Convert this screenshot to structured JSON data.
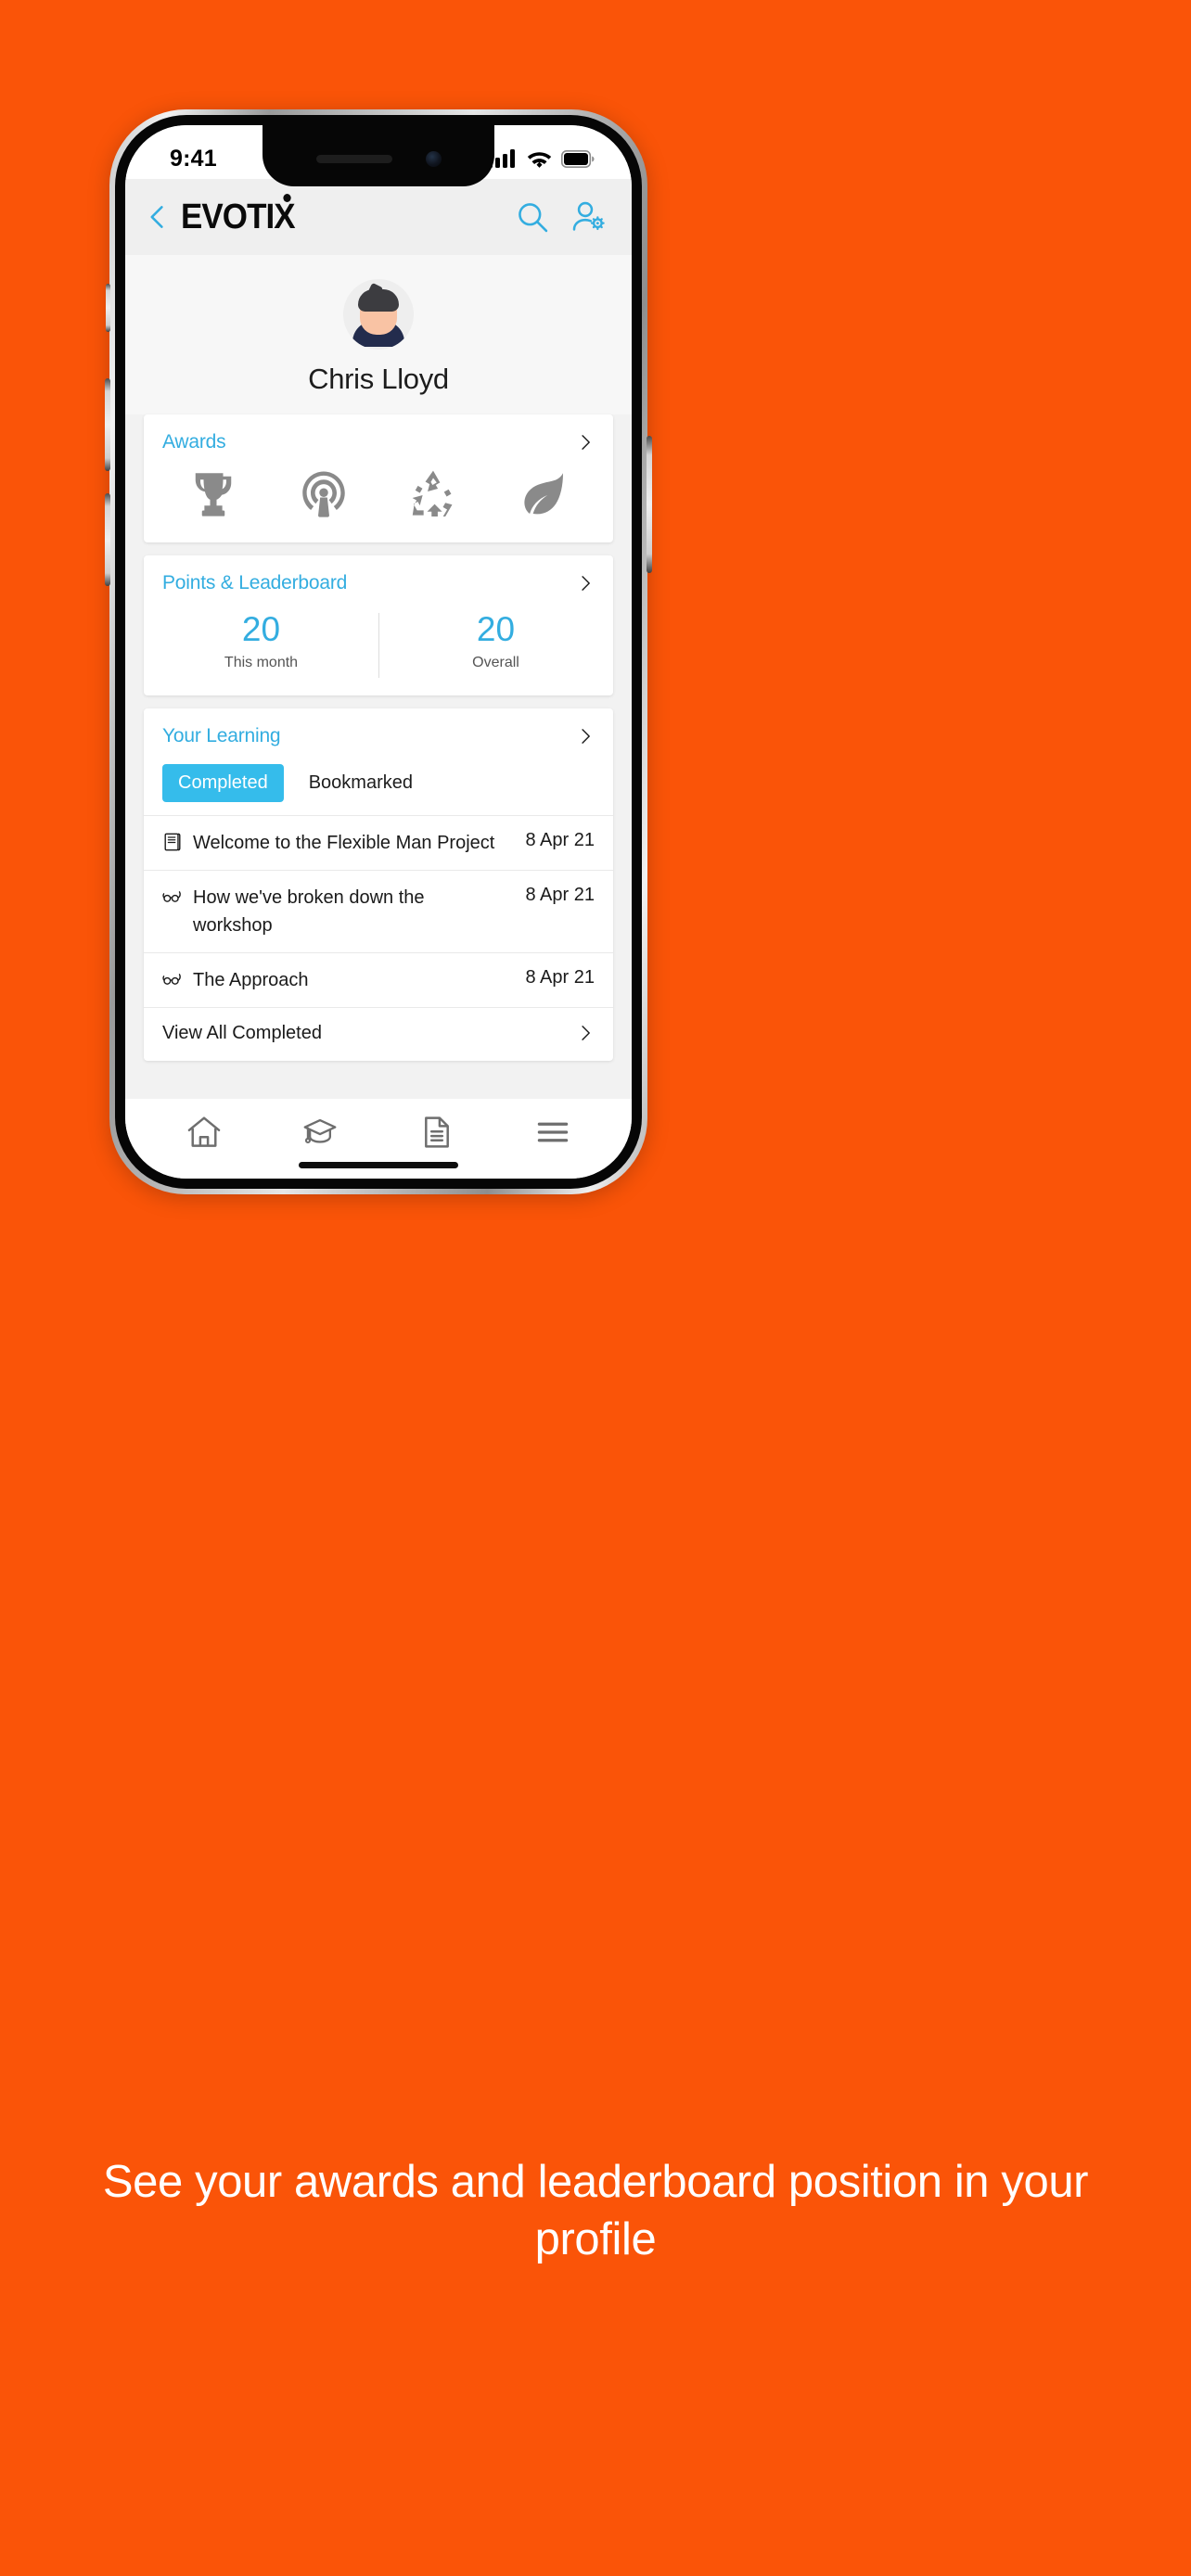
{
  "page": {
    "background_color": "#FA5408",
    "caption": "See your awards and leaderboard position in your profile"
  },
  "status_bar": {
    "time": "9:41",
    "signal_icon": "cellular-signal-icon",
    "wifi_icon": "wifi-icon",
    "battery_icon": "battery-icon"
  },
  "header": {
    "back_icon": "back-chevron-icon",
    "logo_text": "EVOTIX",
    "search_icon": "search-icon",
    "account_settings_icon": "user-settings-icon",
    "accent_color": "#33ADE0"
  },
  "profile": {
    "name": "Chris Lloyd",
    "avatar_icon": "user-avatar"
  },
  "awards": {
    "title": "Awards",
    "chevron_icon": "chevron-right-icon",
    "items": [
      {
        "icon": "trophy-icon"
      },
      {
        "icon": "broadcast-icon"
      },
      {
        "icon": "recycle-icon"
      },
      {
        "icon": "leaf-icon"
      }
    ]
  },
  "points": {
    "title": "Points & Leaderboard",
    "chevron_icon": "chevron-right-icon",
    "stats": [
      {
        "value": "20",
        "label": "This month"
      },
      {
        "value": "20",
        "label": "Overall"
      }
    ]
  },
  "learning": {
    "title": "Your Learning",
    "chevron_icon": "chevron-right-icon",
    "tabs": [
      {
        "label": "Completed",
        "active": true
      },
      {
        "label": "Bookmarked",
        "active": false
      }
    ],
    "items": [
      {
        "icon": "book-icon",
        "title": "Welcome to the Flexible Man Project",
        "date": "8 Apr 21"
      },
      {
        "icon": "glasses-icon",
        "title": "How we've broken down the workshop",
        "date": "8 Apr 21"
      },
      {
        "icon": "glasses-icon",
        "title": "The Approach",
        "date": "8 Apr 21"
      }
    ],
    "view_all": {
      "label": "View All Completed",
      "chevron_icon": "chevron-right-icon"
    }
  },
  "tabbar": {
    "items": [
      {
        "icon": "home-icon"
      },
      {
        "icon": "graduation-cap-icon"
      },
      {
        "icon": "document-icon"
      },
      {
        "icon": "hamburger-menu-icon"
      }
    ]
  }
}
